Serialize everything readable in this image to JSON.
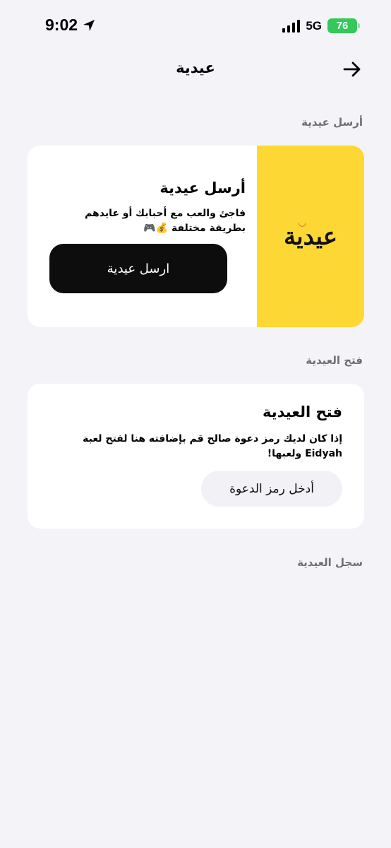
{
  "status_bar": {
    "time": "9:02",
    "network": "5G",
    "battery": "76"
  },
  "nav": {
    "title": "عيدية"
  },
  "sections": {
    "send_label": "أرسل عيدية",
    "open_label": "فتح العيدية",
    "history_label": "سجل العيدية"
  },
  "send_card": {
    "title": "أرسل عيدية",
    "description": "فاجئ والعب مع أحبابك أو عايدهم بطريقة مختلفة 💰🎮",
    "button_label": "ارسل عيدية",
    "brand_logo_text": "عيدية",
    "brand_color": "#fdd835"
  },
  "open_card": {
    "title": "فتح العيدية",
    "description": "إذا كان لديك رمز دعوة صالح قم بإضافته هنا لفتح لعبة Eidyah ولعبها!",
    "button_label": "أدخل رمز الدعوة"
  },
  "icons": {
    "location": "location-arrow-icon",
    "back": "arrow-right-icon"
  }
}
